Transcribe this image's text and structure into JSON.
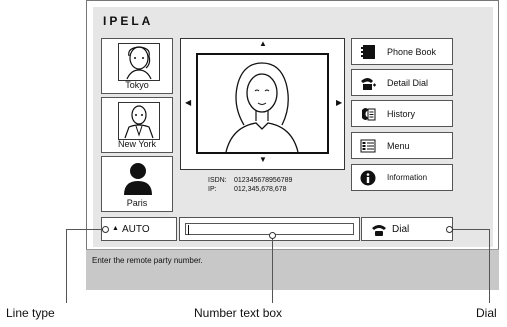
{
  "app": {
    "logo": "IPELA"
  },
  "locations": [
    {
      "label": "Tokyo",
      "icon": "person-portrait-icon"
    },
    {
      "label": "New York",
      "icon": "person-portrait-icon"
    },
    {
      "label": "Paris",
      "icon": "person-silhouette-icon"
    }
  ],
  "camera": {
    "isdn_label": "ISDN:",
    "isdn_value": "012345678956789",
    "ip_label": "IP:",
    "ip_value": "012,345,678,678"
  },
  "menu": [
    {
      "label": "Phone Book",
      "icon": "phone-book-icon"
    },
    {
      "label": "Detail Dial",
      "icon": "detail-dial-icon"
    },
    {
      "label": "History",
      "icon": "history-icon"
    },
    {
      "label": "Menu",
      "icon": "menu-list-icon"
    },
    {
      "label": "Information",
      "icon": "information-icon"
    }
  ],
  "controls": {
    "line_type": "AUTO",
    "number_value": "",
    "dial_label": "Dial"
  },
  "status": {
    "message": "Enter the remote party number."
  },
  "callouts": {
    "line_type": "Line type",
    "number_text_box": "Number text box",
    "dial": "Dial"
  }
}
